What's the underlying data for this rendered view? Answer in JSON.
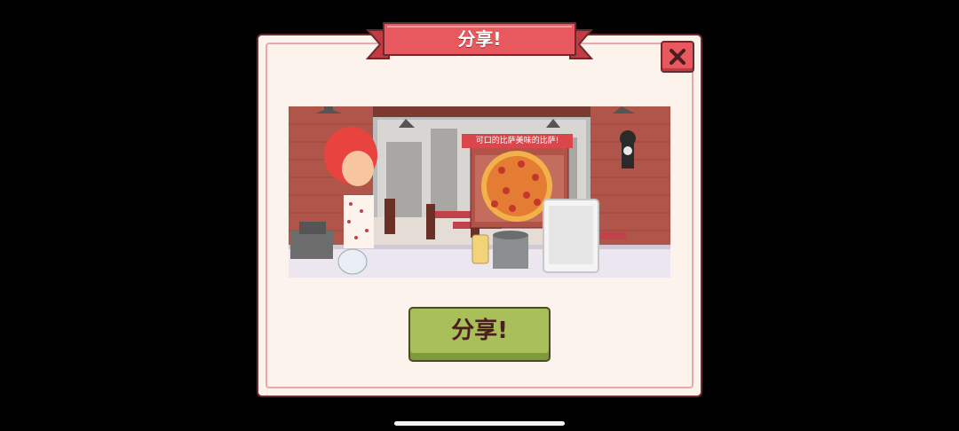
{
  "dialog": {
    "title": "分享!",
    "close_icon": "close-icon",
    "scene_banner": "可口的比萨美味的比萨!",
    "share_button_label": "分享!"
  },
  "colors": {
    "ribbon": "#e8585f",
    "dialog_bg": "#fbf3ec",
    "share_button": "#a8bf5a",
    "outline": "#6b2a2e"
  }
}
